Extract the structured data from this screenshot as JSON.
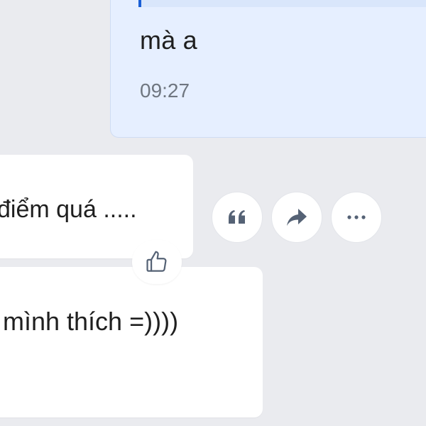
{
  "chat": {
    "sent_message": {
      "text": "mà a",
      "time": "09:27"
    },
    "received_messages": [
      {
        "text": "điểm quá ....."
      },
      {
        "text": "mình thích =))))"
      }
    ],
    "reaction": {
      "icon": "thumbs-up-icon"
    },
    "actions": {
      "quote": {
        "icon": "quote-icon"
      },
      "share": {
        "icon": "share-arrow-icon"
      },
      "more": {
        "icon": "more-dots-icon"
      }
    }
  },
  "colors": {
    "background": "#eaebef",
    "sent_bubble": "#e6efff",
    "received_bubble": "#ffffff",
    "quote_accent": "#1a5fd6",
    "icon_color": "#556275",
    "time_text": "#6f7680"
  }
}
